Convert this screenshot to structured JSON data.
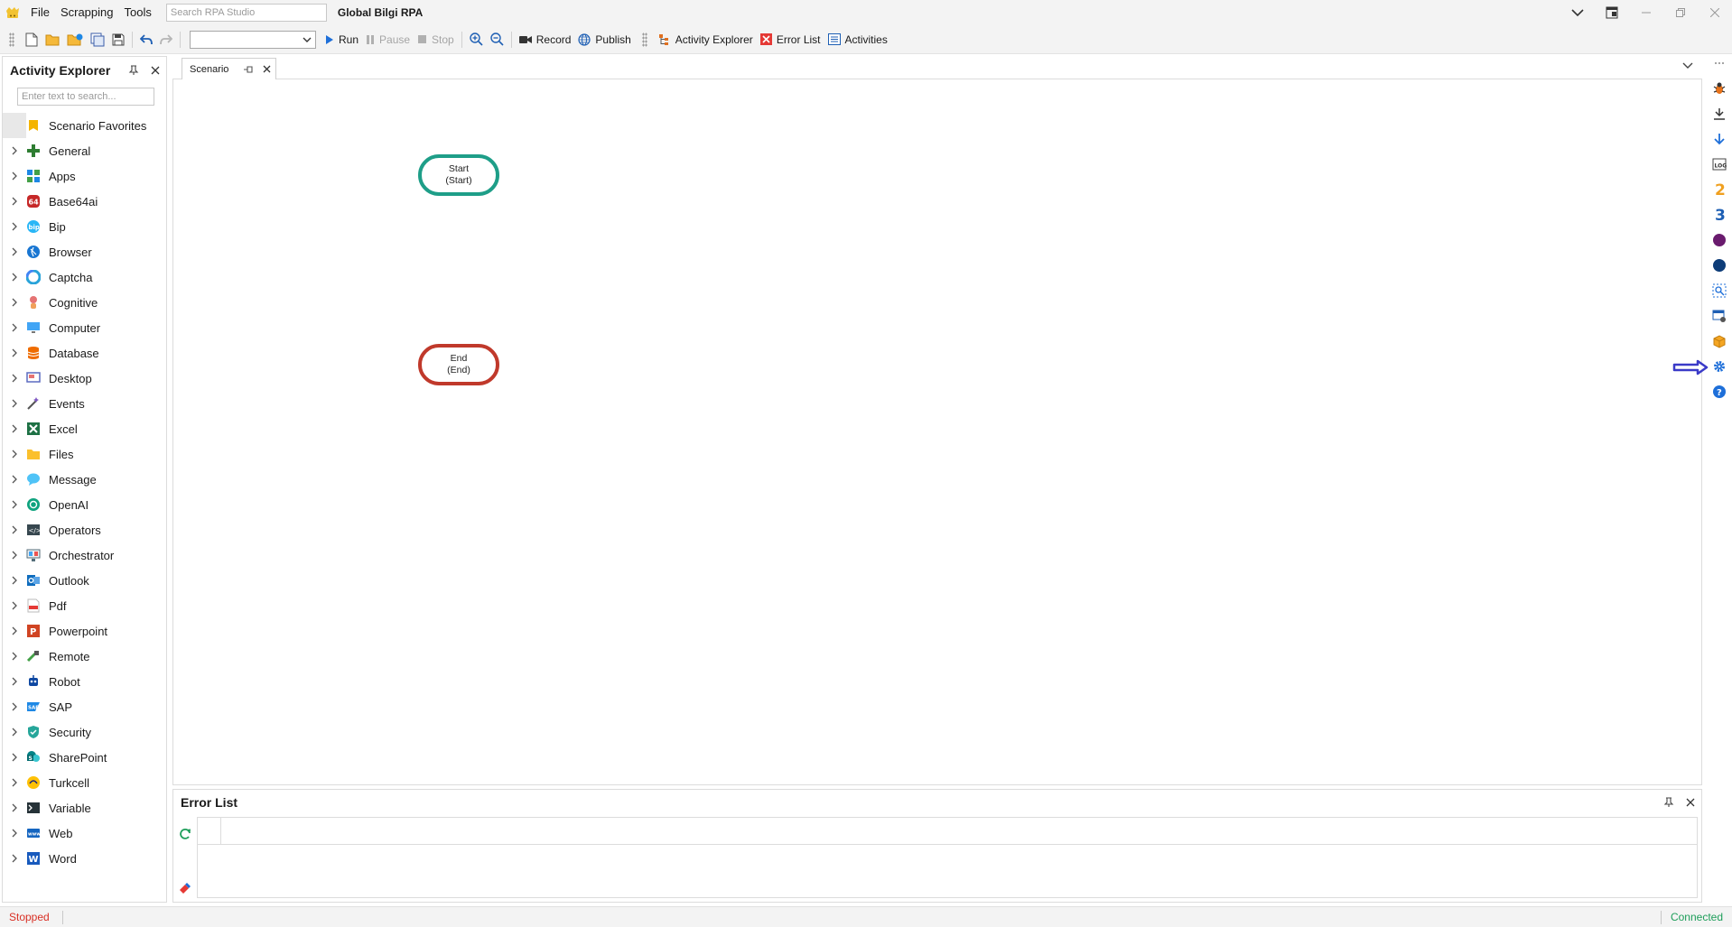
{
  "titlebar": {
    "menu": [
      "File",
      "Scrapping",
      "Tools"
    ],
    "search_placeholder": "Search RPA Studio",
    "app_title": "Global Bilgi RPA"
  },
  "toolbar": {
    "run": "Run",
    "pause": "Pause",
    "stop": "Stop",
    "record": "Record",
    "publish": "Publish",
    "activity_explorer": "Activity Explorer",
    "error_list": "Error List",
    "activities": "Activities",
    "dropdown_value": ""
  },
  "explorer": {
    "title": "Activity Explorer",
    "search_placeholder": "Enter text to search...",
    "items": [
      {
        "label": "Scenario Favorites",
        "icon": "favorites-icon",
        "color": "#f4b400"
      },
      {
        "label": "General",
        "icon": "general-icon",
        "color": "#2e7d32"
      },
      {
        "label": "Apps",
        "icon": "apps-icon",
        "color": "#1e88e5"
      },
      {
        "label": "Base64ai",
        "icon": "base64ai-icon",
        "color": "#c62828"
      },
      {
        "label": "Bip",
        "icon": "bip-icon",
        "color": "#29b6f6"
      },
      {
        "label": "Browser",
        "icon": "browser-icon",
        "color": "#1976d2"
      },
      {
        "label": "Captcha",
        "icon": "captcha-icon",
        "color": "#29a3d9"
      },
      {
        "label": "Cognitive",
        "icon": "cognitive-icon",
        "color": "#e57373"
      },
      {
        "label": "Computer",
        "icon": "computer-icon",
        "color": "#42a5f5"
      },
      {
        "label": "Database",
        "icon": "database-icon",
        "color": "#ef6c00"
      },
      {
        "label": "Desktop",
        "icon": "desktop-icon",
        "color": "#5c6bc0"
      },
      {
        "label": "Events",
        "icon": "events-icon",
        "color": "#7e57c2"
      },
      {
        "label": "Excel",
        "icon": "excel-icon",
        "color": "#1e7145"
      },
      {
        "label": "Files",
        "icon": "files-icon",
        "color": "#fbc02d"
      },
      {
        "label": "Message",
        "icon": "message-icon",
        "color": "#4fc3f7"
      },
      {
        "label": "OpenAI",
        "icon": "openai-icon",
        "color": "#10a37f"
      },
      {
        "label": "Operators",
        "icon": "operators-icon",
        "color": "#37474f"
      },
      {
        "label": "Orchestrator",
        "icon": "orchestrator-icon",
        "color": "#546e7a"
      },
      {
        "label": "Outlook",
        "icon": "outlook-icon",
        "color": "#0f6cbd"
      },
      {
        "label": "Pdf",
        "icon": "pdf-icon",
        "color": "#e53935"
      },
      {
        "label": "Powerpoint",
        "icon": "powerpoint-icon",
        "color": "#d04423"
      },
      {
        "label": "Remote",
        "icon": "remote-icon",
        "color": "#43a047"
      },
      {
        "label": "Robot",
        "icon": "robot-icon",
        "color": "#0d47a1"
      },
      {
        "label": "SAP",
        "icon": "sap-icon",
        "color": "#1e88e5"
      },
      {
        "label": "Security",
        "icon": "security-icon",
        "color": "#26a69a"
      },
      {
        "label": "SharePoint",
        "icon": "sharepoint-icon",
        "color": "#038387"
      },
      {
        "label": "Turkcell",
        "icon": "turkcell-icon",
        "color": "#ffc107"
      },
      {
        "label": "Variable",
        "icon": "variable-icon",
        "color": "#263238"
      },
      {
        "label": "Web",
        "icon": "web-icon",
        "color": "#1565c0"
      },
      {
        "label": "Word",
        "icon": "word-icon",
        "color": "#185abd"
      }
    ]
  },
  "document": {
    "tab_label": "Scenario",
    "nodes": {
      "start": {
        "line1": "Start",
        "line2": "(Start)",
        "color": "#1e9e88"
      },
      "end": {
        "line1": "End",
        "line2": "(End)",
        "color": "#c0392b"
      }
    }
  },
  "rightbar": {
    "icons": [
      "debug-icon",
      "download-icon",
      "arrow-down-icon",
      "log-icon",
      "number-two-icon",
      "number-three-icon",
      "purple-circle-icon",
      "navy-circle-icon",
      "inspect-icon",
      "window-settings-icon",
      "package-icon",
      "settings-gear-icon",
      "help-icon"
    ]
  },
  "error_list": {
    "title": "Error List"
  },
  "statusbar": {
    "left": "Stopped",
    "right": "Connected"
  }
}
